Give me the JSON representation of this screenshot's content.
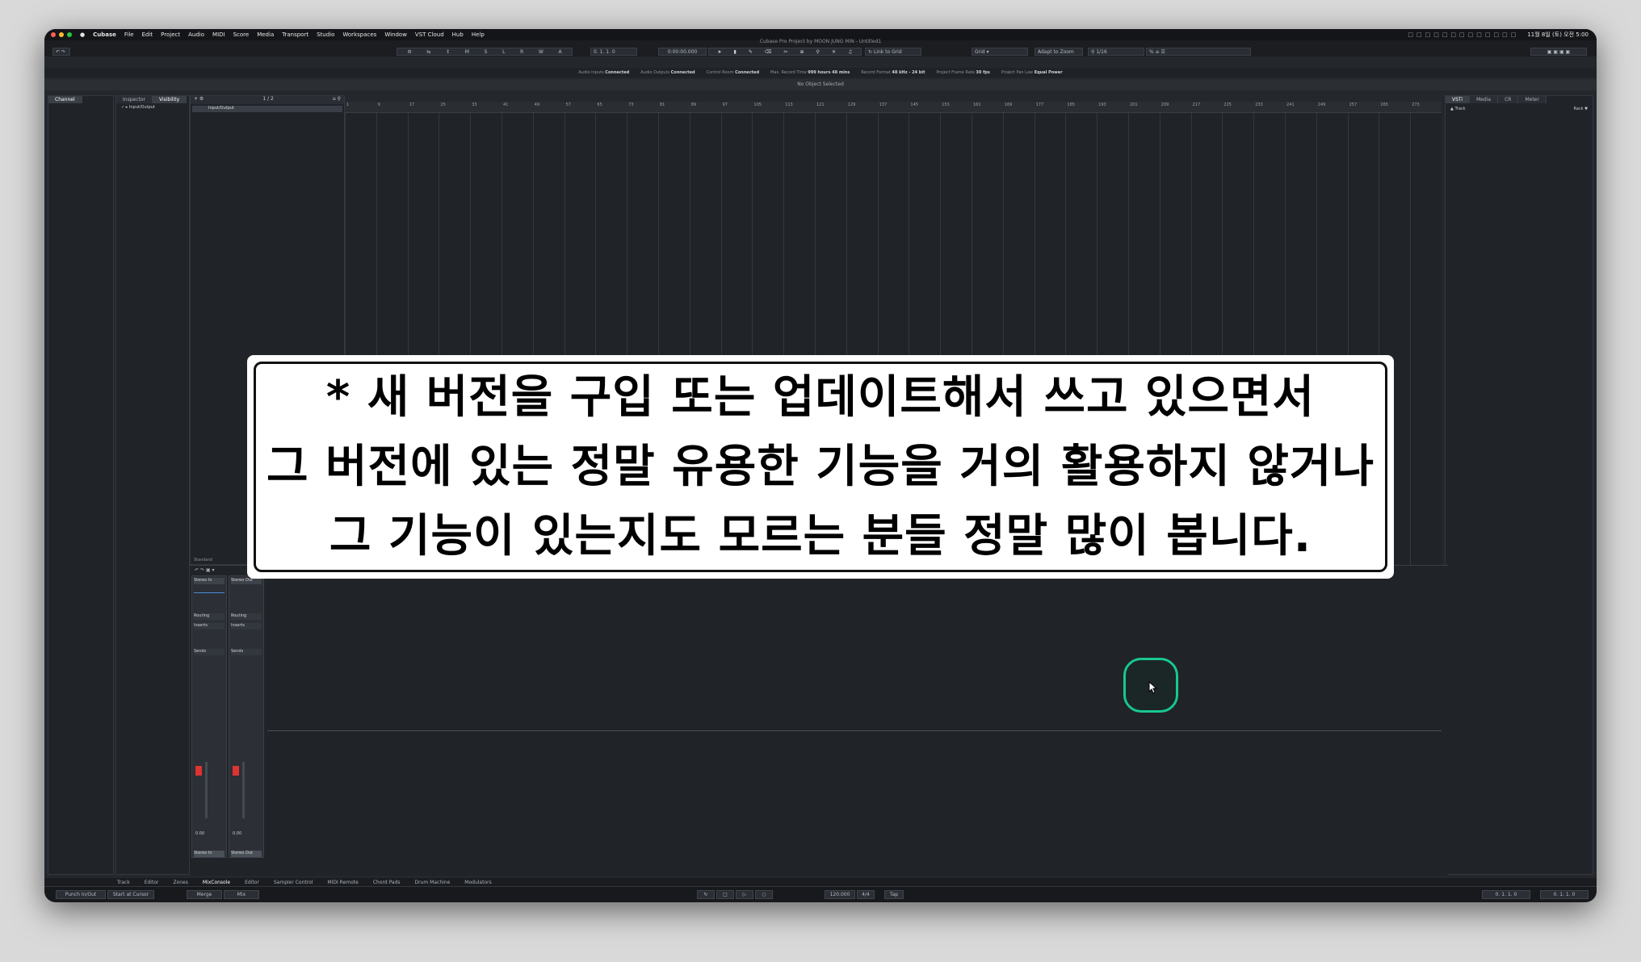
{
  "menubar": {
    "items": [
      "Cubase",
      "File",
      "Edit",
      "Project",
      "Audio",
      "MIDI",
      "Score",
      "Media",
      "Transport",
      "Studio",
      "Workspaces",
      "Window",
      "VST Cloud",
      "Hub",
      "Help"
    ],
    "clock": "11월 8일 (토) 오전 5:00"
  },
  "window_title": "Cubase Pro Project by MOON JUNG MIN - Untitled1",
  "toolbar": {
    "position": "0. 1. 1.   0",
    "time": "0:00:00.000",
    "link": "Link to Grid",
    "grid": "Grid",
    "zoom": "Adapt to Zoom",
    "quantize": "1/16"
  },
  "status_row": [
    {
      "label": "Audio Inputs",
      "value": "Connected"
    },
    {
      "label": "Audio Outputs",
      "value": "Connected"
    },
    {
      "label": "Control Room",
      "value": "Connected"
    },
    {
      "label": "Max. Record Time",
      "value": "999 hours 48 mins"
    },
    {
      "label": "Record Format",
      "value": "48 kHz - 24 bit"
    },
    {
      "label": "Project Frame Rate",
      "value": "30 fps"
    },
    {
      "label": "Project Pan Law",
      "value": "Equal Power"
    }
  ],
  "info_line": "No Object Selected",
  "left_panel": {
    "tab_channel": "Channel",
    "tab_inspector": "Inspector",
    "tab_visibility": "Visibility",
    "visibility_item": "Input/Output",
    "track_header": "Input/Output",
    "track_count": "1 / 2",
    "preset": "Standard"
  },
  "right_panel": {
    "tabs": [
      "VSTi",
      "Media",
      "CR",
      "Meter"
    ],
    "track_label": "Track",
    "rack_label": "Rack"
  },
  "ruler_marks": [
    "1",
    "9",
    "17",
    "25",
    "33",
    "41",
    "49",
    "57",
    "65",
    "73",
    "81",
    "89",
    "97",
    "105",
    "113",
    "121",
    "129",
    "137",
    "145",
    "153",
    "161",
    "169",
    "177",
    "185",
    "193",
    "201",
    "209",
    "217",
    "225",
    "233",
    "241",
    "249",
    "257",
    "265",
    "273"
  ],
  "mixer": {
    "strips": [
      {
        "top_label": "Stereo In",
        "routing": "Routing",
        "inserts": "Inserts",
        "sends": "Sends",
        "name": "Stereo In",
        "gain": "0.00"
      },
      {
        "top_label": "Stereo Out",
        "routing": "Routing",
        "inserts": "Inserts",
        "sends": "Sends",
        "name": "Stereo Out",
        "gain": "0.00"
      }
    ]
  },
  "bottom_tabs": [
    "Track",
    "Editor",
    "Zones",
    "MixConsole",
    "Editor",
    "Sampler Control",
    "MIDI Remote",
    "Chord Pads",
    "Drum Machine",
    "Modulators"
  ],
  "transport": {
    "punch": "Punch In/Out",
    "start": "Start at Cursor",
    "merge": "Merge",
    "mix": "Mix",
    "tempo": "120.000",
    "signature": "4/4",
    "tap": "Tap",
    "left_locator": "0. 1. 1.   0",
    "right_locator": "0. 1. 1.   0"
  },
  "caption": {
    "line1": "* 새 버전을 구입 또는 업데이트해서 쓰고 있으면서",
    "line2": "그 버전에 있는 정말 유용한 기능을 거의 활용하지 않거나",
    "line3": "그 기능이 있는지도 모르는 분들 정말 많이 봅니다."
  },
  "colors": {
    "accent": "#19c78f",
    "window_bg": "#24272c"
  }
}
